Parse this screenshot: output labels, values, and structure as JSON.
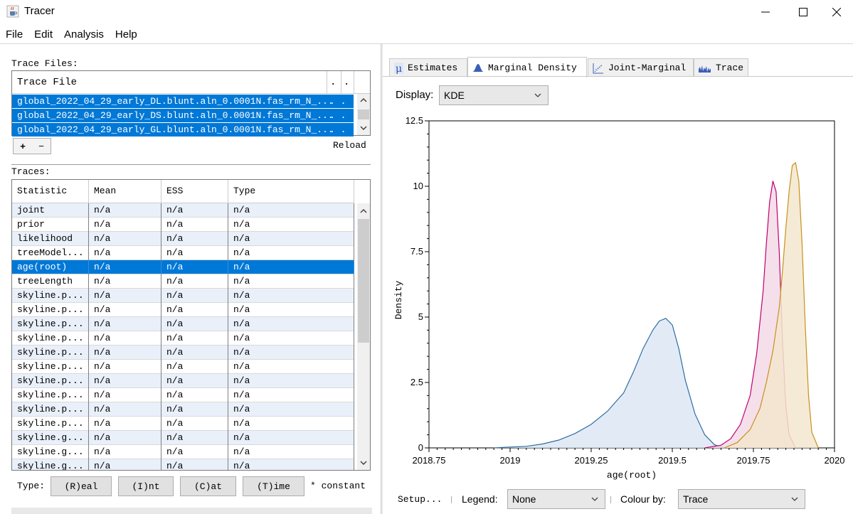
{
  "window": {
    "title": "Tracer",
    "app_icon": "java-coffee-icon"
  },
  "menu": [
    "File",
    "Edit",
    "Analysis",
    "Help"
  ],
  "trace_files": {
    "label": "Trace Files:",
    "header": "Trace File",
    "header_extra": [
      ". . .",
      ". ."
    ],
    "rows": [
      "global_2022_04_29_early_DL.blunt.aln_0.0001N.fas_rm_N_...",
      "global_2022_04_29_early_DS.blunt.aln_0.0001N.fas_rm_N_...",
      "global_2022_04_29_early_GL.blunt.aln_0.0001N.fas_rm_N_..."
    ],
    "row_extra": [
      ". . .",
      ". . ."
    ],
    "add_label": "+",
    "remove_label": "−",
    "reload_label": "Reload"
  },
  "traces": {
    "label": "Traces:",
    "columns": [
      "Statistic",
      "Mean",
      "ESS",
      "Type"
    ],
    "rows": [
      [
        "joint",
        "n/a",
        "n/a",
        "n/a"
      ],
      [
        "prior",
        "n/a",
        "n/a",
        "n/a"
      ],
      [
        "likelihood",
        "n/a",
        "n/a",
        "n/a"
      ],
      [
        "treeModel...",
        "n/a",
        "n/a",
        "n/a"
      ],
      [
        "age(root)",
        "n/a",
        "n/a",
        "n/a"
      ],
      [
        "treeLength",
        "n/a",
        "n/a",
        "n/a"
      ],
      [
        "skyline.p...",
        "n/a",
        "n/a",
        "n/a"
      ],
      [
        "skyline.p...",
        "n/a",
        "n/a",
        "n/a"
      ],
      [
        "skyline.p...",
        "n/a",
        "n/a",
        "n/a"
      ],
      [
        "skyline.p...",
        "n/a",
        "n/a",
        "n/a"
      ],
      [
        "skyline.p...",
        "n/a",
        "n/a",
        "n/a"
      ],
      [
        "skyline.p...",
        "n/a",
        "n/a",
        "n/a"
      ],
      [
        "skyline.p...",
        "n/a",
        "n/a",
        "n/a"
      ],
      [
        "skyline.p...",
        "n/a",
        "n/a",
        "n/a"
      ],
      [
        "skyline.p...",
        "n/a",
        "n/a",
        "n/a"
      ],
      [
        "skyline.p...",
        "n/a",
        "n/a",
        "n/a"
      ],
      [
        "skyline.g...",
        "n/a",
        "n/a",
        "n/a"
      ],
      [
        "skyline.g...",
        "n/a",
        "n/a",
        "n/a"
      ],
      [
        "skyline.g...",
        "n/a",
        "n/a",
        "n/a"
      ]
    ],
    "selected_index": 4
  },
  "type_bar": {
    "label": "Type:",
    "buttons": [
      "(R)eal",
      "(I)nt",
      "(C)at",
      "(T)ime"
    ],
    "note": "* constant"
  },
  "tabs": [
    "Estimates",
    "Marginal Density",
    "Joint-Marginal",
    "Trace"
  ],
  "tab_icons": [
    "mu-icon",
    "density-peak-icon",
    "scatter-icon",
    "trace-icon"
  ],
  "active_tab": 1,
  "display": {
    "label": "Display:",
    "value": "KDE"
  },
  "bottom": {
    "setup_label": "Setup...",
    "legend_label": "Legend:",
    "legend_value": "None",
    "colour_label": "Colour by:",
    "colour_value": "Trace"
  },
  "colors": {
    "selection": "#0078d7",
    "row_alt": "#e9f0fa",
    "series1": "#2f6da4",
    "series2": "#c0006f",
    "series3": "#c8901a"
  },
  "chart_data": {
    "type": "area",
    "title": "",
    "xlabel": "age(root)",
    "ylabel": "Density",
    "xlim": [
      2018.75,
      2020
    ],
    "ylim": [
      0,
      12.5
    ],
    "x_ticks": [
      "2018.75",
      "2019",
      "2019.25",
      "2019.5",
      "2019.75",
      "2020"
    ],
    "y_ticks": [
      "0",
      "2.5",
      "5",
      "7.5",
      "10",
      "12.5"
    ],
    "grid": false,
    "series": [
      {
        "color": "#2f6da4",
        "fill": "#dde8f3",
        "x": [
          2018.95,
          2019.0,
          2019.05,
          2019.1,
          2019.15,
          2019.2,
          2019.25,
          2019.3,
          2019.35,
          2019.38,
          2019.41,
          2019.44,
          2019.46,
          2019.48,
          2019.5,
          2019.52,
          2019.54,
          2019.57,
          2019.6,
          2019.63,
          2019.66
        ],
        "y": [
          0,
          0.03,
          0.06,
          0.15,
          0.3,
          0.55,
          0.9,
          1.4,
          2.1,
          2.9,
          3.8,
          4.5,
          4.85,
          4.95,
          4.7,
          3.8,
          2.6,
          1.3,
          0.5,
          0.12,
          0
        ]
      },
      {
        "color": "#c0006f",
        "fill": "#f2d9e8",
        "x": [
          2019.6,
          2019.65,
          2019.68,
          2019.71,
          2019.74,
          2019.76,
          2019.78,
          2019.79,
          2019.8,
          2019.81,
          2019.82,
          2019.83,
          2019.84,
          2019.85,
          2019.86,
          2019.88
        ],
        "y": [
          0,
          0.1,
          0.35,
          0.9,
          2.0,
          3.6,
          6.0,
          7.8,
          9.4,
          10.2,
          9.8,
          7.4,
          4.0,
          1.6,
          0.5,
          0
        ]
      },
      {
        "color": "#c8901a",
        "fill": "#f3e6cf",
        "x": [
          2019.66,
          2019.7,
          2019.74,
          2019.77,
          2019.79,
          2019.81,
          2019.83,
          2019.84,
          2019.85,
          2019.86,
          2019.87,
          2019.88,
          2019.89,
          2019.9,
          2019.91,
          2019.92,
          2019.93,
          2019.95
        ],
        "y": [
          0,
          0.2,
          0.7,
          1.5,
          2.5,
          3.7,
          5.4,
          6.8,
          8.4,
          9.8,
          10.8,
          10.9,
          10.2,
          7.8,
          4.6,
          2.0,
          0.6,
          0
        ]
      }
    ]
  }
}
